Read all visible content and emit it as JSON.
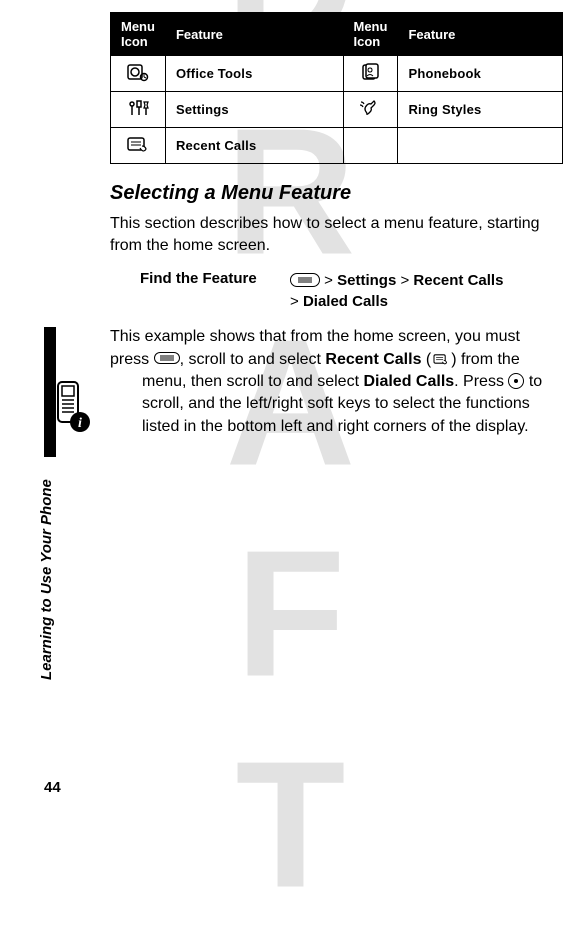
{
  "watermark": "DRAFT",
  "table": {
    "headers": [
      "Menu Icon",
      "Feature",
      "Menu Icon",
      "Feature"
    ],
    "rows": [
      {
        "f1": "Office Tools",
        "f2": "Phonebook"
      },
      {
        "f1": "Settings",
        "f2": "Ring Styles"
      },
      {
        "f1": "Recent Calls",
        "f2": ""
      }
    ]
  },
  "heading": "Selecting a Menu Feature",
  "intro": "This section describes how to select a menu feature, starting from the home screen.",
  "find": {
    "label": "Find the Feature",
    "gt1": ">",
    "p1": "Settings",
    "gt2": ">",
    "p2": "Recent Calls",
    "gt3": ">",
    "p3": "Dialed Calls"
  },
  "example": {
    "t1": "This example shows that from the home screen, you must press ",
    "t2": ", scroll to and select ",
    "recent": "Recent Calls",
    "t3": " (",
    "t4": ") from the ",
    "t5": "menu, then scroll to and select ",
    "dialed": "Dialed Calls",
    "t6": ". Press ",
    "t7": " to scroll, and the left/right soft keys to select the functions listed in the bottom left and right corners of the display."
  },
  "side_label": "Learning to Use Your Phone",
  "page_number": "44"
}
